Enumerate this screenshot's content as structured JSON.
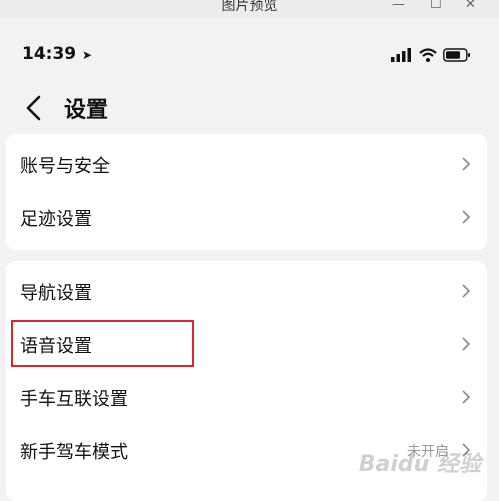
{
  "window": {
    "title": "图片预览",
    "minimize": "—",
    "maximize": "☐",
    "close": "✕"
  },
  "status_bar": {
    "time": "14:39",
    "location_arrow": "➤"
  },
  "nav": {
    "title": "设置"
  },
  "groups": [
    {
      "rows": [
        {
          "label": "账号与安全"
        },
        {
          "label": "足迹设置"
        }
      ]
    },
    {
      "rows": [
        {
          "label": "导航设置"
        },
        {
          "label": "语音设置"
        },
        {
          "label": "手车互联设置"
        },
        {
          "label": "新手驾车模式",
          "value": "未开启"
        }
      ]
    }
  ],
  "highlight_color": "#e0242a",
  "watermark": "Baidu 经验"
}
